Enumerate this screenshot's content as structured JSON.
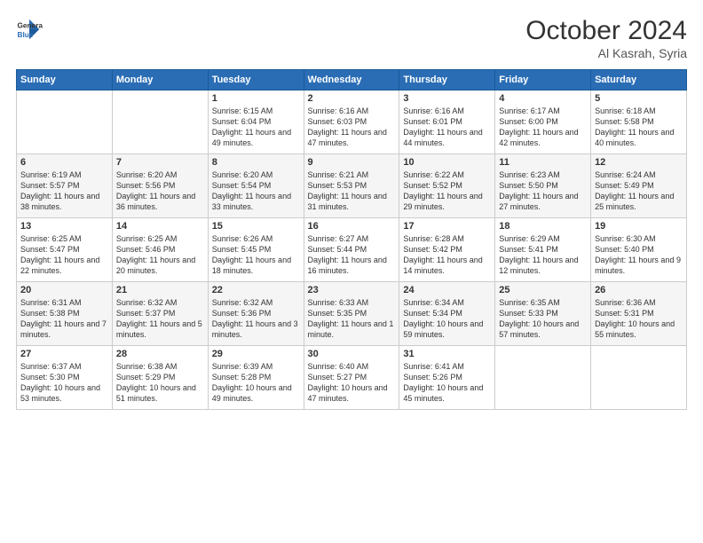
{
  "logo": {
    "line1": "General",
    "line2": "Blue"
  },
  "header": {
    "month": "October 2024",
    "location": "Al Kasrah, Syria"
  },
  "weekdays": [
    "Sunday",
    "Monday",
    "Tuesday",
    "Wednesday",
    "Thursday",
    "Friday",
    "Saturday"
  ],
  "weeks": [
    [
      {
        "day": "",
        "sunrise": "",
        "sunset": "",
        "daylight": ""
      },
      {
        "day": "",
        "sunrise": "",
        "sunset": "",
        "daylight": ""
      },
      {
        "day": "1",
        "sunrise": "Sunrise: 6:15 AM",
        "sunset": "Sunset: 6:04 PM",
        "daylight": "Daylight: 11 hours and 49 minutes."
      },
      {
        "day": "2",
        "sunrise": "Sunrise: 6:16 AM",
        "sunset": "Sunset: 6:03 PM",
        "daylight": "Daylight: 11 hours and 47 minutes."
      },
      {
        "day": "3",
        "sunrise": "Sunrise: 6:16 AM",
        "sunset": "Sunset: 6:01 PM",
        "daylight": "Daylight: 11 hours and 44 minutes."
      },
      {
        "day": "4",
        "sunrise": "Sunrise: 6:17 AM",
        "sunset": "Sunset: 6:00 PM",
        "daylight": "Daylight: 11 hours and 42 minutes."
      },
      {
        "day": "5",
        "sunrise": "Sunrise: 6:18 AM",
        "sunset": "Sunset: 5:58 PM",
        "daylight": "Daylight: 11 hours and 40 minutes."
      }
    ],
    [
      {
        "day": "6",
        "sunrise": "Sunrise: 6:19 AM",
        "sunset": "Sunset: 5:57 PM",
        "daylight": "Daylight: 11 hours and 38 minutes."
      },
      {
        "day": "7",
        "sunrise": "Sunrise: 6:20 AM",
        "sunset": "Sunset: 5:56 PM",
        "daylight": "Daylight: 11 hours and 36 minutes."
      },
      {
        "day": "8",
        "sunrise": "Sunrise: 6:20 AM",
        "sunset": "Sunset: 5:54 PM",
        "daylight": "Daylight: 11 hours and 33 minutes."
      },
      {
        "day": "9",
        "sunrise": "Sunrise: 6:21 AM",
        "sunset": "Sunset: 5:53 PM",
        "daylight": "Daylight: 11 hours and 31 minutes."
      },
      {
        "day": "10",
        "sunrise": "Sunrise: 6:22 AM",
        "sunset": "Sunset: 5:52 PM",
        "daylight": "Daylight: 11 hours and 29 minutes."
      },
      {
        "day": "11",
        "sunrise": "Sunrise: 6:23 AM",
        "sunset": "Sunset: 5:50 PM",
        "daylight": "Daylight: 11 hours and 27 minutes."
      },
      {
        "day": "12",
        "sunrise": "Sunrise: 6:24 AM",
        "sunset": "Sunset: 5:49 PM",
        "daylight": "Daylight: 11 hours and 25 minutes."
      }
    ],
    [
      {
        "day": "13",
        "sunrise": "Sunrise: 6:25 AM",
        "sunset": "Sunset: 5:47 PM",
        "daylight": "Daylight: 11 hours and 22 minutes."
      },
      {
        "day": "14",
        "sunrise": "Sunrise: 6:25 AM",
        "sunset": "Sunset: 5:46 PM",
        "daylight": "Daylight: 11 hours and 20 minutes."
      },
      {
        "day": "15",
        "sunrise": "Sunrise: 6:26 AM",
        "sunset": "Sunset: 5:45 PM",
        "daylight": "Daylight: 11 hours and 18 minutes."
      },
      {
        "day": "16",
        "sunrise": "Sunrise: 6:27 AM",
        "sunset": "Sunset: 5:44 PM",
        "daylight": "Daylight: 11 hours and 16 minutes."
      },
      {
        "day": "17",
        "sunrise": "Sunrise: 6:28 AM",
        "sunset": "Sunset: 5:42 PM",
        "daylight": "Daylight: 11 hours and 14 minutes."
      },
      {
        "day": "18",
        "sunrise": "Sunrise: 6:29 AM",
        "sunset": "Sunset: 5:41 PM",
        "daylight": "Daylight: 11 hours and 12 minutes."
      },
      {
        "day": "19",
        "sunrise": "Sunrise: 6:30 AM",
        "sunset": "Sunset: 5:40 PM",
        "daylight": "Daylight: 11 hours and 9 minutes."
      }
    ],
    [
      {
        "day": "20",
        "sunrise": "Sunrise: 6:31 AM",
        "sunset": "Sunset: 5:38 PM",
        "daylight": "Daylight: 11 hours and 7 minutes."
      },
      {
        "day": "21",
        "sunrise": "Sunrise: 6:32 AM",
        "sunset": "Sunset: 5:37 PM",
        "daylight": "Daylight: 11 hours and 5 minutes."
      },
      {
        "day": "22",
        "sunrise": "Sunrise: 6:32 AM",
        "sunset": "Sunset: 5:36 PM",
        "daylight": "Daylight: 11 hours and 3 minutes."
      },
      {
        "day": "23",
        "sunrise": "Sunrise: 6:33 AM",
        "sunset": "Sunset: 5:35 PM",
        "daylight": "Daylight: 11 hours and 1 minute."
      },
      {
        "day": "24",
        "sunrise": "Sunrise: 6:34 AM",
        "sunset": "Sunset: 5:34 PM",
        "daylight": "Daylight: 10 hours and 59 minutes."
      },
      {
        "day": "25",
        "sunrise": "Sunrise: 6:35 AM",
        "sunset": "Sunset: 5:33 PM",
        "daylight": "Daylight: 10 hours and 57 minutes."
      },
      {
        "day": "26",
        "sunrise": "Sunrise: 6:36 AM",
        "sunset": "Sunset: 5:31 PM",
        "daylight": "Daylight: 10 hours and 55 minutes."
      }
    ],
    [
      {
        "day": "27",
        "sunrise": "Sunrise: 6:37 AM",
        "sunset": "Sunset: 5:30 PM",
        "daylight": "Daylight: 10 hours and 53 minutes."
      },
      {
        "day": "28",
        "sunrise": "Sunrise: 6:38 AM",
        "sunset": "Sunset: 5:29 PM",
        "daylight": "Daylight: 10 hours and 51 minutes."
      },
      {
        "day": "29",
        "sunrise": "Sunrise: 6:39 AM",
        "sunset": "Sunset: 5:28 PM",
        "daylight": "Daylight: 10 hours and 49 minutes."
      },
      {
        "day": "30",
        "sunrise": "Sunrise: 6:40 AM",
        "sunset": "Sunset: 5:27 PM",
        "daylight": "Daylight: 10 hours and 47 minutes."
      },
      {
        "day": "31",
        "sunrise": "Sunrise: 6:41 AM",
        "sunset": "Sunset: 5:26 PM",
        "daylight": "Daylight: 10 hours and 45 minutes."
      },
      {
        "day": "",
        "sunrise": "",
        "sunset": "",
        "daylight": ""
      },
      {
        "day": "",
        "sunrise": "",
        "sunset": "",
        "daylight": ""
      }
    ]
  ]
}
